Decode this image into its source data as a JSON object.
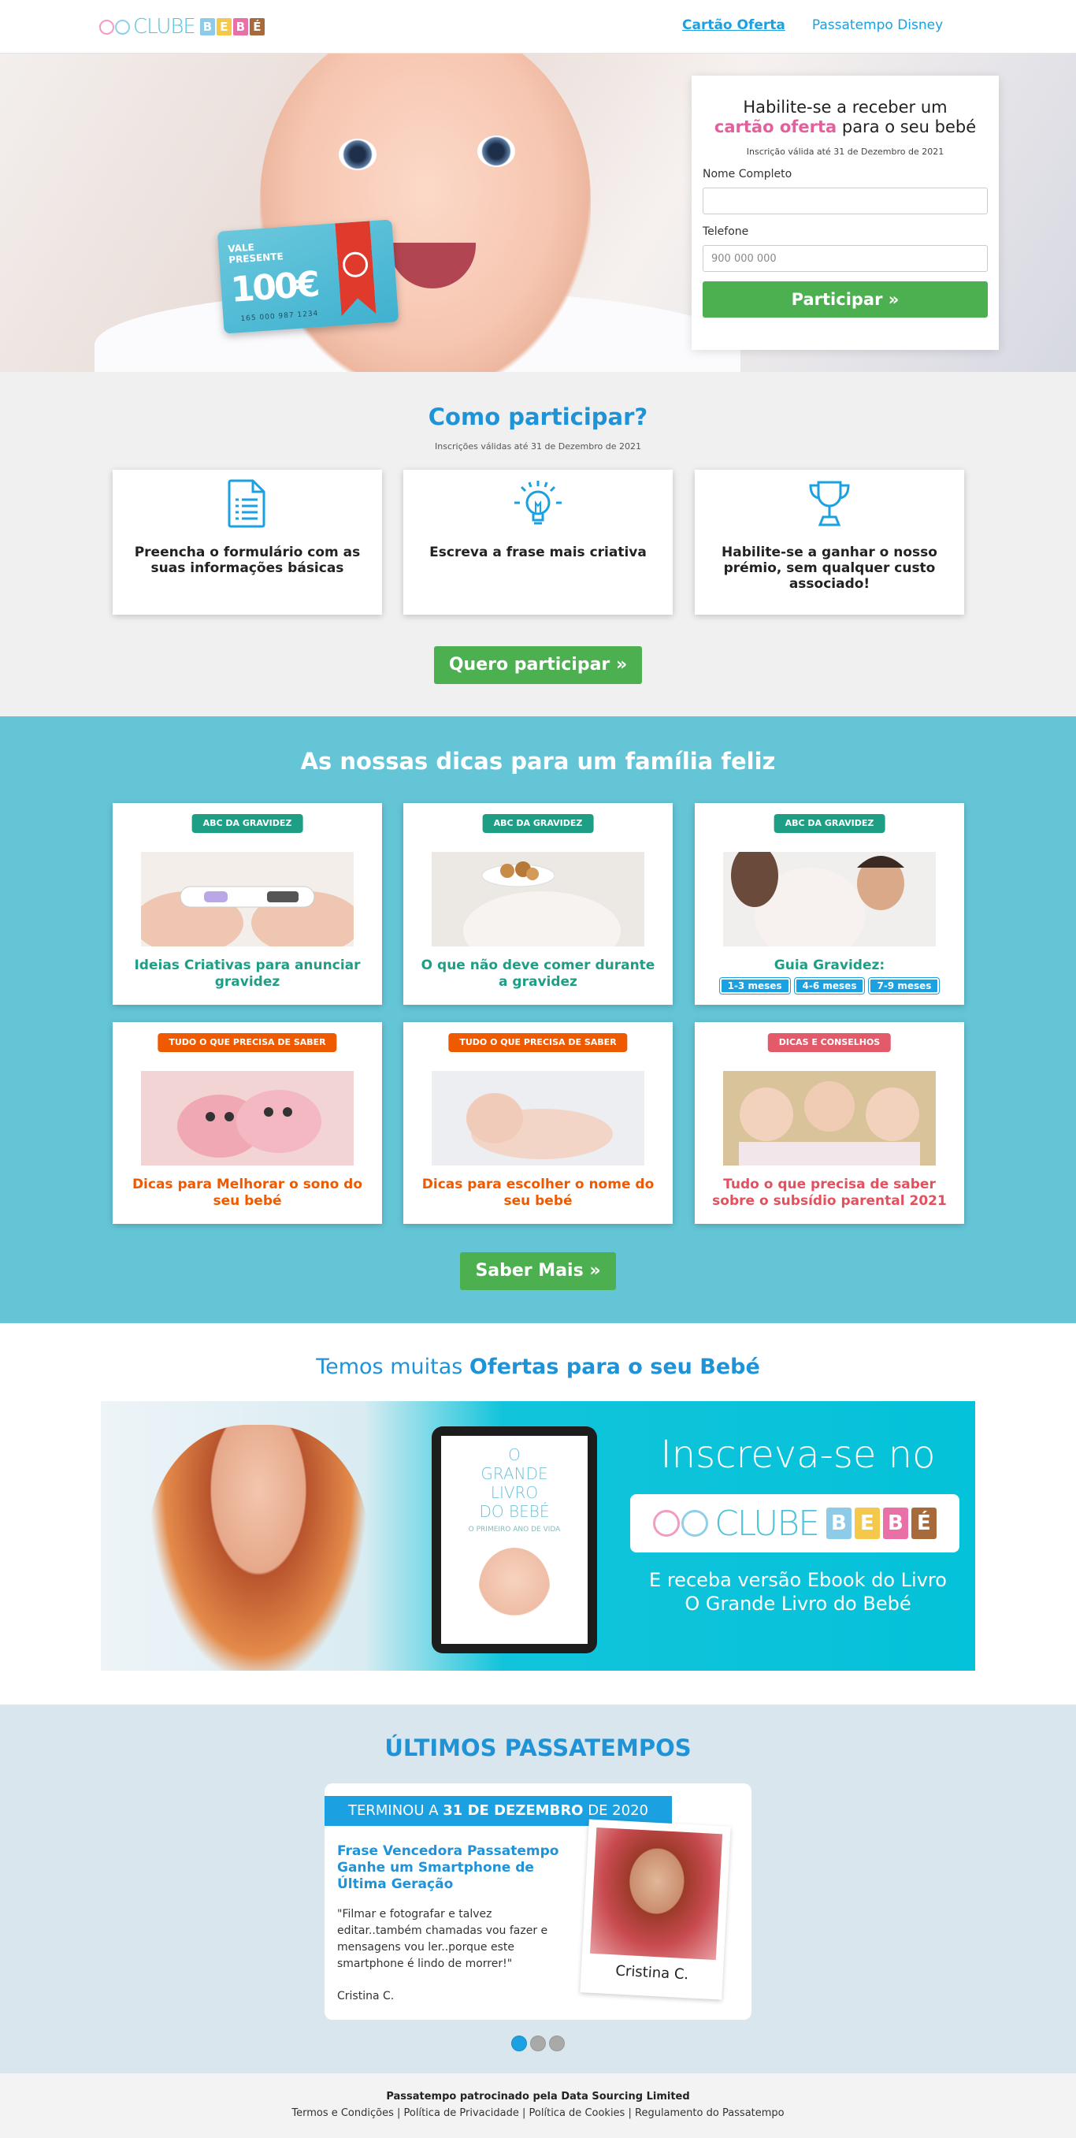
{
  "header": {
    "logo": {
      "text": "CLUBE",
      "letters": [
        "B",
        "E",
        "B",
        "É"
      ],
      "letter_colors": [
        "#8ecbe8",
        "#f4c84a",
        "#e970a7",
        "#a86a3a"
      ]
    },
    "nav": [
      {
        "label": "Cartão Oferta",
        "active": true
      },
      {
        "label": "Passatempo Disney",
        "active": false
      }
    ]
  },
  "hero": {
    "gift_card": {
      "label_line1": "VALE",
      "label_line2": "PRESENTE",
      "amount": "100€",
      "number": "165 000 987 1234"
    },
    "form": {
      "title_line1": "Habilite-se a receber um",
      "title_highlight": "cartão oferta",
      "title_rest": " para o seu bebé",
      "valid_text": "Inscrição válida até 31 de Dezembro de 2021",
      "name_label": "Nome Completo",
      "name_value": "",
      "phone_label": "Telefone",
      "phone_placeholder": "900 000 000",
      "submit_label": "Participar »"
    }
  },
  "how": {
    "title": "Como participar?",
    "subtitle": "Inscrições válidas até 31 de Dezembro de 2021",
    "steps": [
      {
        "icon": "document-icon",
        "text": "Preencha o formulário com as suas informações básicas"
      },
      {
        "icon": "lightbulb-icon",
        "text": "Escreva a frase mais criativa"
      },
      {
        "icon": "trophy-icon",
        "text": "Habilite-se a ganhar o nosso prémio, sem qualquer custo associado!"
      }
    ],
    "cta_label": "Quero participar »"
  },
  "tips": {
    "title": "As nossas dicas para um família feliz",
    "cards": [
      {
        "badge": "ABC DA GRAVIDEZ",
        "title": "Ideias Criativas para anunciar gravidez"
      },
      {
        "badge": "ABC DA GRAVIDEZ",
        "title": "O que não deve comer durante a gravidez"
      },
      {
        "badge": "ABC DA GRAVIDEZ",
        "title": "Guia Gravidez:",
        "months": [
          "1-3 meses",
          "4-6 meses",
          "7-9 meses"
        ]
      },
      {
        "badge": "TUDO O QUE PRECISA DE SABER",
        "title": "Dicas para Melhorar o sono do seu bebé"
      },
      {
        "badge": "TUDO O QUE PRECISA DE SABER",
        "title": "Dicas para escolher o nome do seu bebé"
      },
      {
        "badge": "DICAS E CONSELHOS",
        "title": "Tudo o que precisa de saber sobre o subsídio parental 2021"
      }
    ],
    "cta_label": "Saber Mais »"
  },
  "offers": {
    "title_pre": "Temos muitas ",
    "title_bold": "Ofertas para o seu Bebé",
    "banner": {
      "book_title_l1": "O",
      "book_title_l2": "GRANDE",
      "book_title_l3": "LIVRO",
      "book_title_l4": "DO BEBÉ",
      "book_sub": "O PRIMEIRO ANO DE VIDA",
      "headline": "Inscreva-se no",
      "logo_text": "CLUBE",
      "receive_l1": "E receba versão Ebook do Livro",
      "receive_l2": "O Grande Livro do Bebé"
    }
  },
  "last": {
    "title": "ÚLTIMOS PASSATEMPOS",
    "ended_pre": "TERMINOU A ",
    "ended_bold": "31 DE DEZEMBRO",
    "ended_post": " DE 2020",
    "win_title": "Frase Vencedora Passatempo Ganhe um Smartphone de Última Geração",
    "quote": "\"Filmar e fotografar e talvez editar..também chamadas vou fazer e mensagens vou ler..porque este smartphone é lindo de morrer!\"",
    "winner": "Cristina C.",
    "photo_caption": "Cristina C."
  },
  "footer": {
    "sponsor": "Passatempo patrocinado pela Data Sourcing Limited",
    "links": [
      "Termos e Condições",
      "Política de Privacidade",
      "Política de Cookies",
      "Regulamento do Passatempo"
    ],
    "separator": " | "
  },
  "colors": {
    "accent": "#1ba0e1",
    "green": "#4caf50",
    "teal_bg": "#64c5d7",
    "pink": "#e4609d"
  }
}
